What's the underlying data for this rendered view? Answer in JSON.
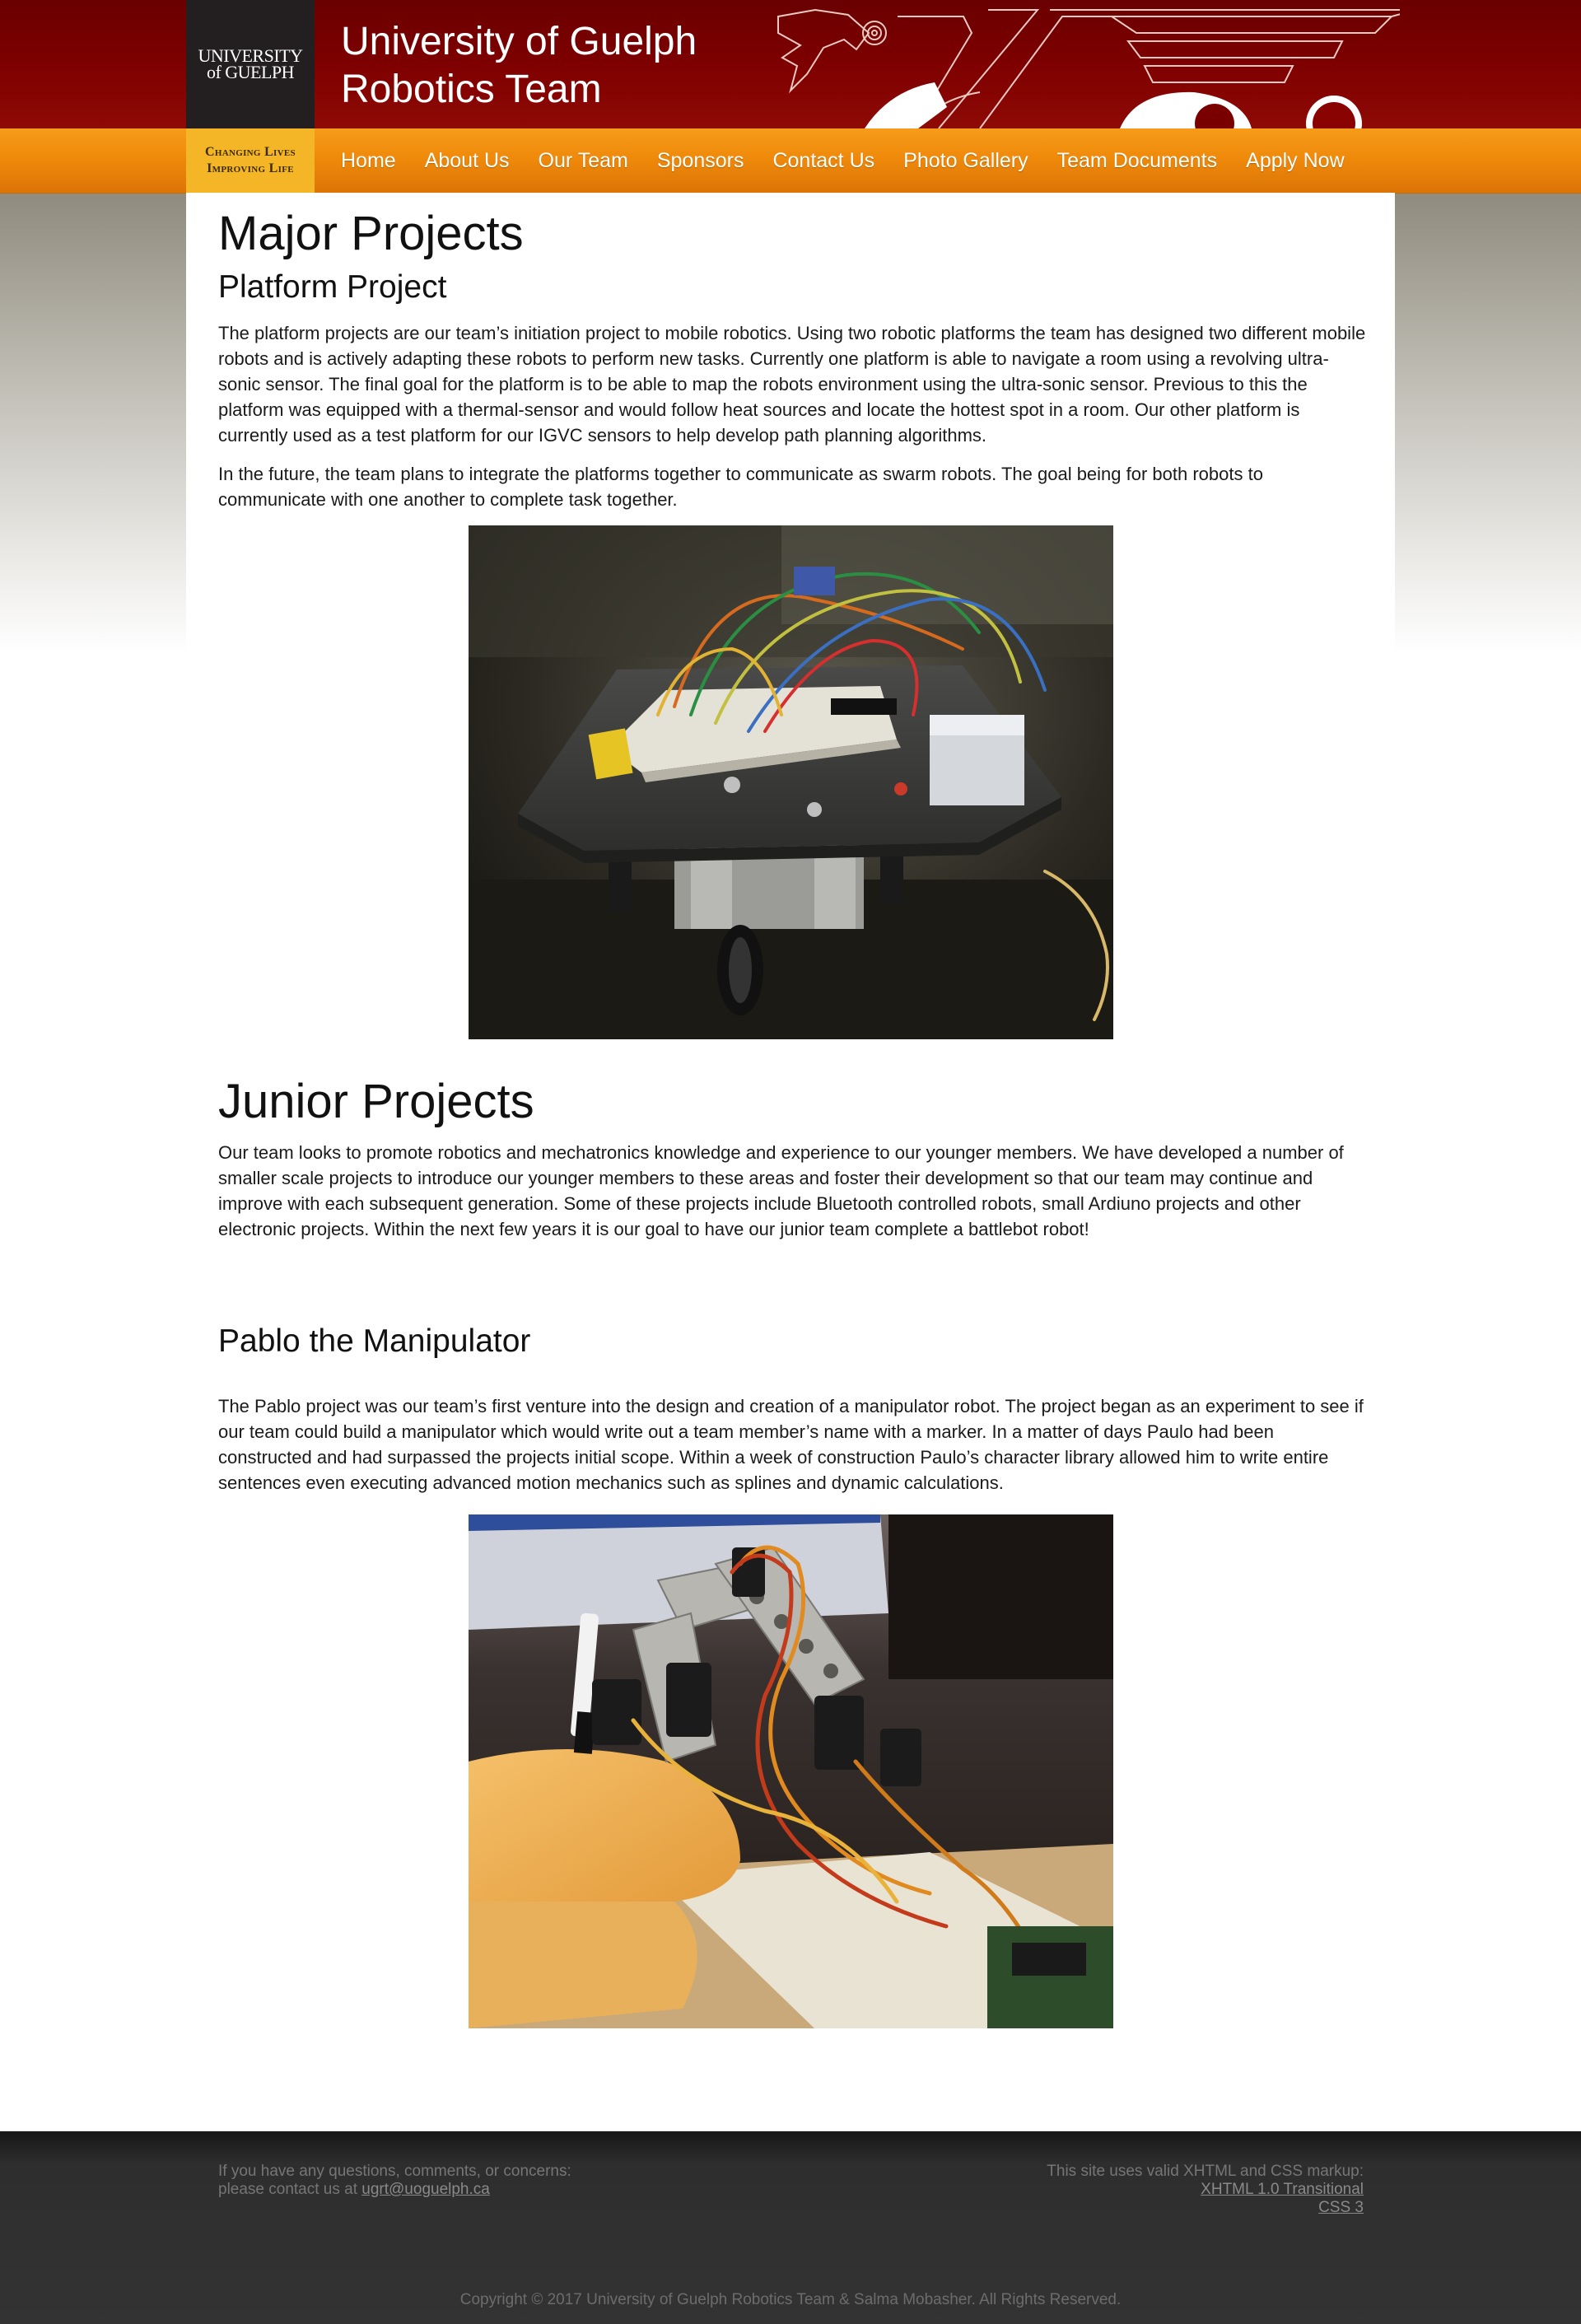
{
  "header": {
    "logo_line1": "UNIVERSITY",
    "logo_line2": "of GUELPH",
    "title_line1": "University of Guelph",
    "title_line2": "Robotics Team",
    "tagline_line1": "Changing Lives",
    "tagline_line2": "Improving Life"
  },
  "nav": {
    "items": [
      "Home",
      "About Us",
      "Our Team",
      "Sponsors",
      "Contact Us",
      "Photo Gallery",
      "Team Documents",
      "Apply Now"
    ]
  },
  "main": {
    "major_heading": "Major Projects",
    "platform_heading": "Platform Project",
    "platform_p1": "The platform projects are our team’s initiation project to mobile robotics. Using two robotic platforms the team has designed two different mobile robots and is actively adapting these robots to perform new tasks. Currently one platform is able to navigate a room using a revolving ultra-sonic sensor. The final goal for the platform is to be able to map the robots environment using the ultra-sonic sensor. Previous to this the platform was equipped with a thermal-sensor and would follow heat sources and locate the hottest spot in a room. Our other platform is currently used as a test platform for our IGVC sensors to help develop path planning algorithms.",
    "platform_p2": "In the future, the team plans to integrate the platforms together to communicate as swarm robots. The goal being for both robots to communicate with one another to complete task together.",
    "junior_heading": "Junior Projects",
    "junior_p": "Our team looks to promote robotics and mechatronics knowledge and experience to our younger members. We have developed a number of smaller scale projects to introduce our younger members to these areas and foster their development so that our team may continue and improve with each subsequent generation. Some of these projects include Bluetooth controlled robots, small Ardiuno projects and other electronic projects. Within the next few years it is our goal to have our junior team complete a battlebot robot!",
    "pablo_heading": "Pablo the Manipulator",
    "pablo_p": "The Pablo project was our team’s first venture into the design and creation of a manipulator robot. The project began as an experiment to see if our team could build a manipulator which would write out a team member’s name with a marker. In a matter of days Paulo had been constructed and had surpassed the projects initial scope. Within a week of construction Paulo’s character library allowed him to write entire sentences even executing advanced motion mechanics such as splines and dynamic calculations."
  },
  "footer": {
    "left_line1": "If you have any questions, comments, or concerns:",
    "left_line2_prefix": "please contact us at ",
    "email": "ugrt@uoguelph.ca",
    "right_line1": "This site uses valid XHTML and CSS markup:",
    "xhtml_link": "XHTML 1.0 Transitional",
    "css_link": "CSS 3",
    "copyright": "Copyright © 2017 University of Guelph Robotics Team & Salma Mobasher. All Rights Reserved."
  },
  "colors": {
    "header_red": "#7e0000",
    "nav_orange": "#ef8a0b",
    "tagline_gold": "#f4b526",
    "footer_gray": "#333333"
  }
}
